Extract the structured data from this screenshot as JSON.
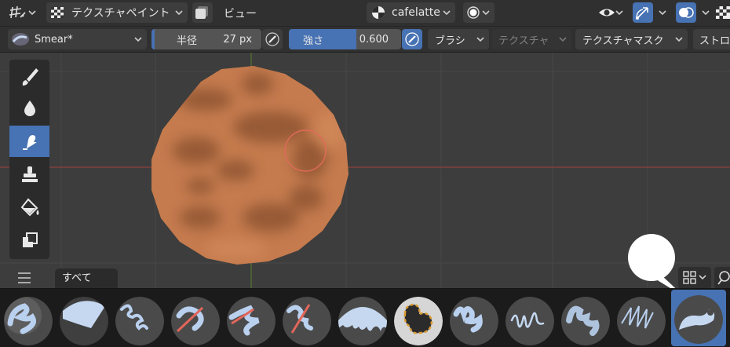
{
  "header": {
    "mode_label": "テクスチャペイント",
    "view_label": "ビュー",
    "image_name": "cafelatte"
  },
  "tool_header": {
    "brush_name": "Smear*",
    "radius": {
      "label": "半径",
      "value": "27 px"
    },
    "strength": {
      "label": "強さ",
      "value": "0.600",
      "fraction": 0.6
    },
    "brush_menu": "ブラシ",
    "texture_menu": "テクスチャ",
    "texture_mask_menu": "テクスチャマスク",
    "stroke_menu": "ストロ"
  },
  "toolbar": {
    "tools": [
      "draw-tool",
      "blur-tool",
      "smear-tool",
      "clone-tool",
      "fill-tool",
      "mask-tool"
    ],
    "active_tool": "smear-tool"
  },
  "asset_shelf": {
    "tab_label": "すべて",
    "brush_count": 13,
    "selected_index": 12
  },
  "colors": {
    "accent": "#4772b3",
    "panel": "#303030",
    "viewport": "#3d3d3d",
    "axis_x": "#c4504e",
    "axis_y": "#6f9a2c",
    "sphere": "#c57b4e"
  }
}
